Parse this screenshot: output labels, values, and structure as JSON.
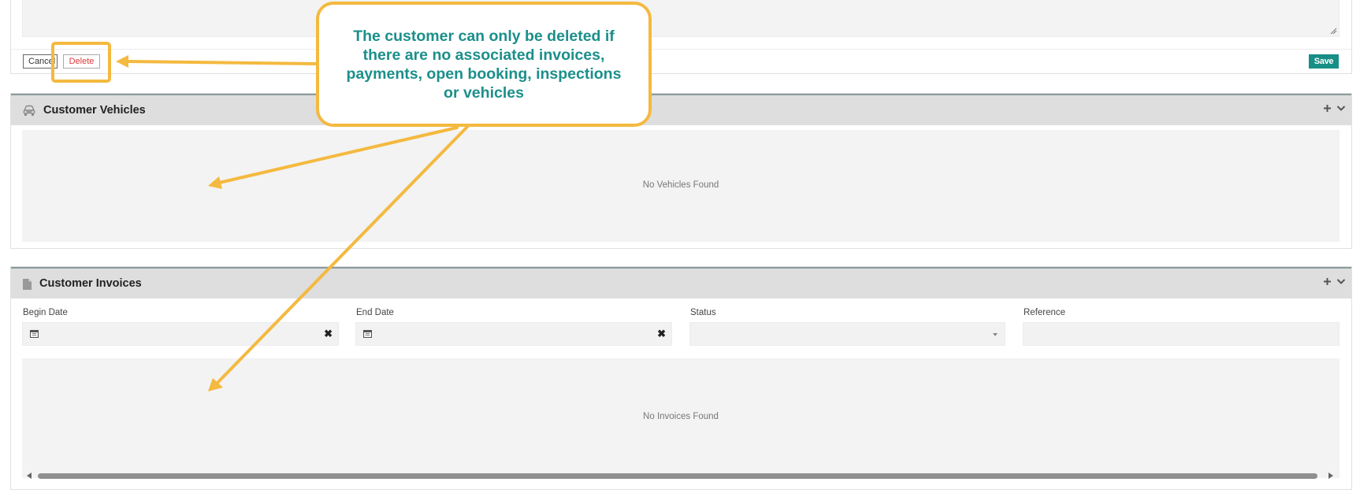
{
  "top_form": {
    "cancel_label": "Cancel",
    "delete_label": "Delete",
    "save_label": "Save"
  },
  "vehicles": {
    "title": "Customer Vehicles",
    "icon": "car-icon",
    "empty_message": "No Vehicles Found"
  },
  "invoices": {
    "title": "Customer Invoices",
    "icon": "document-icon",
    "filters": {
      "begin_date_label": "Begin Date",
      "begin_date_value": "",
      "end_date_label": "End Date",
      "end_date_value": "",
      "status_label": "Status",
      "status_value": "",
      "reference_label": "Reference",
      "reference_value": ""
    },
    "empty_message": "No Invoices Found"
  },
  "annotation": {
    "callout_text": "The customer can only be deleted if there are no associated invoices, payments, open booking, inspections or vehicles"
  },
  "colors": {
    "accent_teal": "#178f86",
    "callout_border": "#f4b93f",
    "callout_text": "#1b8f8a",
    "delete_red": "#e03a3a",
    "header_gray": "#dedede"
  }
}
